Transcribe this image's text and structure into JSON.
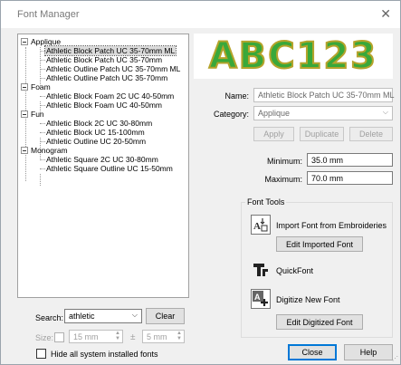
{
  "window": {
    "title": "Font Manager",
    "close_icon": "close-icon"
  },
  "tree": {
    "categories": [
      {
        "label": "Applique",
        "items": [
          "Athletic Block Patch UC 35-70mm ML",
          "Athletic Block Patch UC 35-70mm",
          "Athletic Outline Patch UC 35-70mm ML",
          "Athletic Outline Patch UC 35-70mm"
        ]
      },
      {
        "label": "Foam",
        "items": [
          "Athletic Block Foam 2C UC 40-50mm",
          "Athletic Block Foam UC 40-50mm"
        ]
      },
      {
        "label": "Fun",
        "items": [
          "Athletic Block 2C UC 30-80mm",
          "Athletic Block UC 15-100mm",
          "Athletic Outline UC 20-50mm"
        ]
      },
      {
        "label": "Monogram",
        "items": [
          "Athletic Square 2C UC 30-80mm",
          "Athletic Square Outline UC 15-50mm"
        ]
      }
    ],
    "selected": "Athletic Block Patch UC 35-70mm ML"
  },
  "search": {
    "label": "Search:",
    "value": "athletic",
    "clear_label": "Clear"
  },
  "size": {
    "label": "Size:",
    "value": "15 mm",
    "tolerance_symbol": "±",
    "tolerance_value": "5 mm",
    "checked": false
  },
  "hide_system": {
    "label": "Hide all system installed fonts",
    "checked": false
  },
  "preview": {
    "text": "ABC123",
    "fill_color": "#39a83a",
    "outline_color": "#b5a32b"
  },
  "details": {
    "name_label": "Name:",
    "name_value": "Athletic Block Patch UC 35-70mm ML",
    "category_label": "Category:",
    "category_value": "Applique",
    "apply_label": "Apply",
    "duplicate_label": "Duplicate",
    "delete_label": "Delete",
    "minimum_label": "Minimum:",
    "minimum_value": "35.0 mm",
    "maximum_label": "Maximum:",
    "maximum_value": "70.0 mm"
  },
  "font_tools": {
    "title": "Font Tools",
    "import_label": "Import Font from Embroideries",
    "edit_imported_label": "Edit Imported Font",
    "quickfont_label": "QuickFont",
    "digitize_label": "Digitize New Font",
    "edit_digitized_label": "Edit Digitized Font"
  },
  "footer": {
    "close_label": "Close",
    "help_label": "Help"
  }
}
